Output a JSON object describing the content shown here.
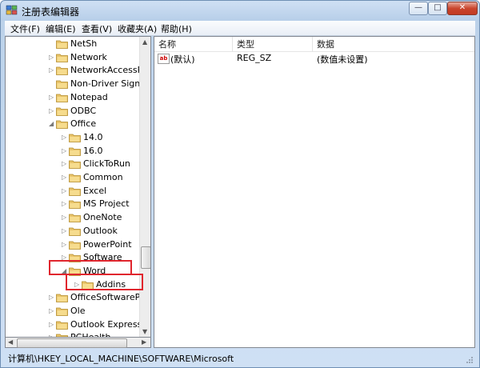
{
  "window": {
    "title": "注册表编辑器",
    "min_glyph": "—",
    "max_glyph": "□",
    "close_glyph": "✕"
  },
  "menu": [
    "文件(F)",
    "编辑(E)",
    "查看(V)",
    "收藏夹(A)",
    "帮助(H)"
  ],
  "tree": {
    "items": [
      {
        "label": "NetSh",
        "level": 0,
        "expander": ""
      },
      {
        "label": "Network",
        "level": 0,
        "expander": "▷"
      },
      {
        "label": "NetworkAccessPr",
        "level": 0,
        "expander": "▷"
      },
      {
        "label": "Non-Driver Signin",
        "level": 0,
        "expander": ""
      },
      {
        "label": "Notepad",
        "level": 0,
        "expander": "▷"
      },
      {
        "label": "ODBC",
        "level": 0,
        "expander": "▷"
      },
      {
        "label": "Office",
        "level": 0,
        "expander": "◢"
      },
      {
        "label": "14.0",
        "level": 1,
        "expander": "▷"
      },
      {
        "label": "16.0",
        "level": 1,
        "expander": "▷"
      },
      {
        "label": "ClickToRun",
        "level": 1,
        "expander": "▷"
      },
      {
        "label": "Common",
        "level": 1,
        "expander": "▷"
      },
      {
        "label": "Excel",
        "level": 1,
        "expander": "▷"
      },
      {
        "label": "MS Project",
        "level": 1,
        "expander": "▷"
      },
      {
        "label": "OneNote",
        "level": 1,
        "expander": "▷"
      },
      {
        "label": "Outlook",
        "level": 1,
        "expander": "▷"
      },
      {
        "label": "PowerPoint",
        "level": 1,
        "expander": "▷"
      },
      {
        "label": "Software",
        "level": 1,
        "expander": "▷"
      },
      {
        "label": "Word",
        "level": 1,
        "expander": "◢"
      },
      {
        "label": "Addins",
        "level": 2,
        "expander": "▷"
      },
      {
        "label": "OfficeSoftwarePro",
        "level": 0,
        "expander": "▷"
      },
      {
        "label": "Ole",
        "level": 0,
        "expander": "▷"
      },
      {
        "label": "Outlook Express",
        "level": 0,
        "expander": "▷"
      },
      {
        "label": "PCHealth",
        "level": 0,
        "expander": "▷"
      }
    ]
  },
  "list": {
    "columns": [
      "名称",
      "类型",
      "数据"
    ],
    "rows": [
      {
        "icon": "ab",
        "name": "(默认)",
        "type": "REG_SZ",
        "data": "(数值未设置)"
      }
    ]
  },
  "status": {
    "path": "计算机\\HKEY_LOCAL_MACHINE\\SOFTWARE\\Microsoft"
  },
  "colors": {
    "highlight": "#e0262e",
    "folder": "#e9c46a"
  }
}
